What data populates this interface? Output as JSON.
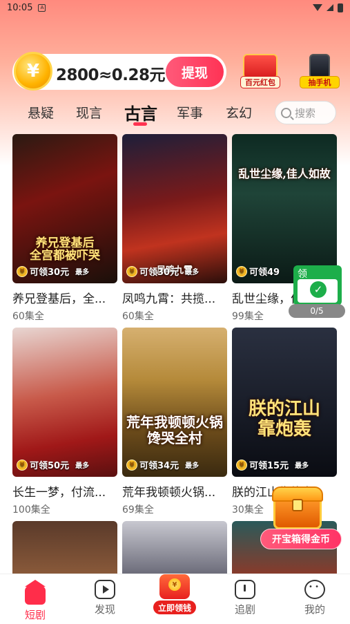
{
  "status_bar": {
    "time": "10:05",
    "notification_icon": "A"
  },
  "coin_card": {
    "amount_text": "2800≈0.28元",
    "withdraw_label": "提现",
    "coin_symbol": "¥"
  },
  "promos": [
    {
      "label": "百元红包"
    },
    {
      "label": "抽手机"
    }
  ],
  "tabs": [
    {
      "label": "悬疑"
    },
    {
      "label": "现言"
    },
    {
      "label": "古言"
    },
    {
      "label": "军事"
    },
    {
      "label": "玄幻"
    }
  ],
  "active_tab": "古言",
  "search": {
    "placeholder": "搜索"
  },
  "cards": [
    {
      "title": "养兄登基后，全...",
      "episodes": "60集全",
      "poster_text": "养兄登基后\n全宫都被吓哭",
      "reward": "可领30元",
      "reward_suffix": "最多"
    },
    {
      "title": "凤鸣九霄：共揽...",
      "episodes": "60集全",
      "poster_text": "凤鸣九霄",
      "reward": "可领30元",
      "reward_suffix": "最多"
    },
    {
      "title": "乱世尘缘，佳人...",
      "episodes": "99集全",
      "poster_text": "乱世尘缘,佳人如故",
      "reward": "可领49",
      "reward_suffix": ""
    },
    {
      "title": "长生一梦，付流...",
      "episodes": "100集全",
      "poster_text": "",
      "reward": "可领50元",
      "reward_suffix": "最多"
    },
    {
      "title": "荒年我顿顿火锅...",
      "episodes": "69集全",
      "poster_text": "荒年我顿顿火锅\n馋哭全村",
      "reward": "可领34元",
      "reward_suffix": "最多"
    },
    {
      "title": "朕的江山靠炮轰",
      "episodes": "30集全",
      "poster_text": "朕的江山\n靠炮轰",
      "reward": "可领15元",
      "reward_suffix": "最多"
    },
    {
      "title": "",
      "episodes": "",
      "poster_text": "",
      "reward": "",
      "reward_suffix": ""
    },
    {
      "title": "",
      "episodes": "",
      "poster_text": "",
      "reward": "",
      "reward_suffix": ""
    },
    {
      "title": "",
      "episodes": "",
      "poster_text": "",
      "reward": "",
      "reward_suffix": ""
    }
  ],
  "float_task": {
    "label": "领",
    "progress": "0/5"
  },
  "treasure": {
    "label": "开宝箱得金币"
  },
  "bottom_nav": [
    {
      "label": "短剧"
    },
    {
      "label": "发现"
    },
    {
      "label": "立即领钱"
    },
    {
      "label": "追剧"
    },
    {
      "label": "我的"
    }
  ],
  "colors": {
    "accent": "#ff2d4a",
    "withdraw": "#ff3355",
    "float_task": "#1dae4a"
  },
  "icons": [
    "home-icon",
    "play-icon",
    "clock-icon",
    "face-icon",
    "search-icon",
    "coin-icon",
    "check-icon",
    "wifi-icon",
    "signal-icon",
    "battery-icon"
  ]
}
